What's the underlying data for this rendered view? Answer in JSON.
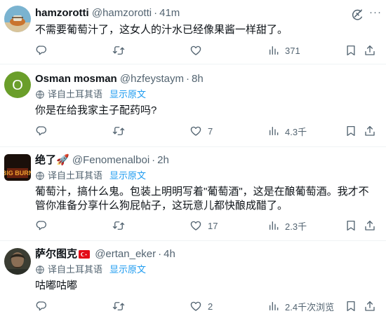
{
  "tweets": [
    {
      "name": "hamzorotti",
      "handle": "@hamzorotti",
      "time": "41m",
      "translated": false,
      "text": "不需要葡萄汁了，这女人的汁水已经像果酱一样甜了。",
      "reply_count": "",
      "retweet_count": "",
      "like_count": "",
      "views": "371"
    },
    {
      "name": "Osman mosman",
      "handle": "@hzfeystaym",
      "time": "8h",
      "avatar_letter": "O",
      "avatar_color": "#6a9e2a",
      "translated": true,
      "translate_note": "译自土耳其语",
      "show_original": "显示原文",
      "text": "你是在给我家主子配药吗?",
      "reply_count": "",
      "retweet_count": "",
      "like_count": "7",
      "views": "4.3千"
    },
    {
      "name": "绝了🚀",
      "handle": "@Fenomenalboi",
      "time": "2h",
      "avatar_text": "BIG BURN",
      "translated": true,
      "translate_note": "译自土耳其语",
      "show_original": "显示原文",
      "text": "葡萄汁，搞什么鬼。包装上明明写着\"葡萄酒\"，这是在酿葡萄酒。我才不管你准备分享什么狗屁帖子，这玩意儿都快酿成醋了。",
      "reply_count": "",
      "retweet_count": "",
      "like_count": "17",
      "views": "2.3千"
    },
    {
      "name": "萨尔图克",
      "handle": "@ertan_eker",
      "time": "4h",
      "translated": true,
      "translate_note": "译自土耳其语",
      "show_original": "显示原文",
      "text": "咕嘟咕嘟",
      "reply_count": "",
      "retweet_count": "",
      "like_count": "2",
      "views": "2.4千次浏览"
    }
  ],
  "separator": "·",
  "more_label": "···",
  "colors": {
    "text": "#0f1419",
    "muted": "#536471",
    "link": "#1d9bf0",
    "border": "#eff3f4",
    "turkey_red": "#e30a17"
  },
  "icons": [
    "grok-icon",
    "more-icon",
    "translate-icon",
    "reply-icon",
    "retweet-icon",
    "like-icon",
    "views-icon",
    "bookmark-icon",
    "share-icon"
  ]
}
